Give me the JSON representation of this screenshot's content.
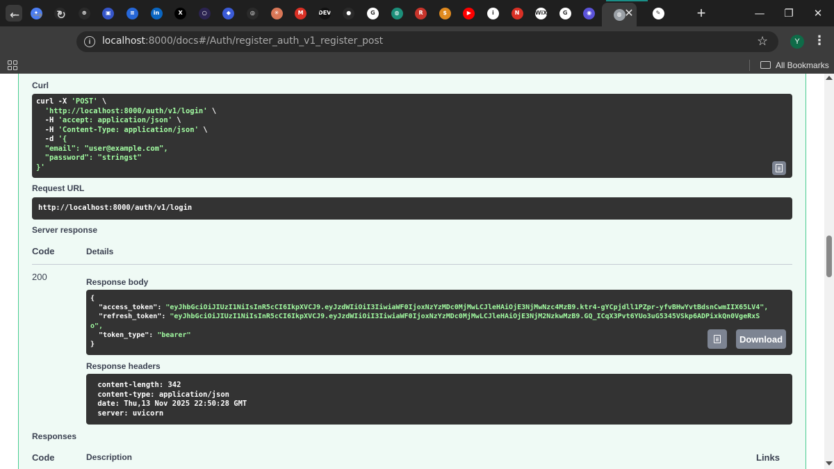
{
  "browser": {
    "tabs": [
      {
        "icon": "gemini-icon",
        "glyph": "✦",
        "color": "#4b7df2"
      },
      {
        "icon": "chatgpt-icon",
        "glyph": "⊛",
        "color": "#2a2a2a"
      },
      {
        "icon": "openai-icon",
        "glyph": "⊛",
        "color": "#2a2a2a"
      },
      {
        "icon": "save-icon",
        "glyph": "▣",
        "color": "#3656c9"
      },
      {
        "icon": "menu-app-icon",
        "glyph": "≡",
        "color": "#2667d8"
      },
      {
        "icon": "linkedin-icon",
        "glyph": "in",
        "color": "#0a66c2"
      },
      {
        "icon": "x-twitter-icon",
        "glyph": "X",
        "color": "#000000"
      },
      {
        "icon": "circle-app-icon",
        "glyph": "○",
        "color": "#2b2350"
      },
      {
        "icon": "vscode-icon",
        "glyph": "◆",
        "color": "#3b5bd6"
      },
      {
        "icon": "ring-app-icon",
        "glyph": "◎",
        "color": "#2a2a2a"
      },
      {
        "icon": "claude-icon",
        "glyph": "✳",
        "color": "#d97757"
      },
      {
        "icon": "gmail-icon",
        "glyph": "M",
        "color": "#d93025"
      },
      {
        "icon": "dev-icon",
        "glyph": "DEV",
        "color": "#111111"
      },
      {
        "icon": "github-icon",
        "glyph": "●",
        "color": "#2a2a2a"
      },
      {
        "icon": "google-icon",
        "glyph": "G",
        "color": "#ffffff"
      },
      {
        "icon": "globe-app-icon",
        "glyph": "◍",
        "color": "#1c8f7a"
      },
      {
        "icon": "redux-icon",
        "glyph": "R",
        "color": "#c7342b"
      },
      {
        "icon": "dollar-app-icon",
        "glyph": "$",
        "color": "#e08a1f"
      },
      {
        "icon": "youtube-icon",
        "glyph": "▶",
        "color": "#ff0000"
      },
      {
        "icon": "info-app-icon",
        "glyph": "i",
        "color": "#ffffff"
      },
      {
        "icon": "notion-like-icon",
        "glyph": "N",
        "color": "#d93025"
      },
      {
        "icon": "wix-icon",
        "glyph": "WiX",
        "color": "#ffffff"
      },
      {
        "icon": "google-icon",
        "glyph": "G",
        "color": "#ffffff"
      },
      {
        "icon": "chat-app-icon",
        "glyph": "◉",
        "color": "#5b53d9"
      },
      {
        "icon": "globe-icon",
        "glyph": "◍",
        "color": "#9aa0a6"
      },
      {
        "icon": "pencil-app-icon",
        "glyph": "✎",
        "color": "#ffffff"
      }
    ],
    "url_host": "localhost",
    "url_path": ":8000/docs#/Auth/register_auth_v1_register_post",
    "profile_initial": "Y",
    "all_bookmarks": "All Bookmarks"
  },
  "curl": {
    "heading": "Curl",
    "lines": [
      {
        "plain": "curl -X ",
        "str": "'POST'",
        "tail": " \\"
      },
      {
        "plain": "  ",
        "str": "'http://localhost:8000/auth/v1/login'",
        "tail": " \\"
      },
      {
        "plain": "  -H ",
        "str": "'accept: application/json'",
        "tail": " \\"
      },
      {
        "plain": "  -H ",
        "str": "'Content-Type: application/json'",
        "tail": " \\"
      },
      {
        "plain": "  -d ",
        "str": "'{",
        "tail": ""
      },
      {
        "plain": "",
        "str": "  \"email\": \"user@example.com\",",
        "tail": ""
      },
      {
        "plain": "",
        "str": "  \"password\": \"stringst\"",
        "tail": ""
      },
      {
        "plain": "",
        "str": "}'",
        "tail": ""
      }
    ]
  },
  "request_url": {
    "heading": "Request URL",
    "value": "http://localhost:8000/auth/v1/login"
  },
  "server_response": {
    "heading": "Server response",
    "code_header": "Code",
    "details_header": "Details",
    "status_code": "200",
    "body_heading": "Response body",
    "body_lines": [
      {
        "plain": "{",
        "str": ""
      },
      {
        "plain": "  \"access_token\": ",
        "str": "\"eyJhbGciOiJIUzI1NiIsInR5cCI6IkpXVCJ9.eyJzdWIiOiI3IiwiaWF0IjoxNzYzMDc0MjMwLCJleHAiOjE3NjMwNzc4MzB9.ktr4-gYCpjdll1PZpr-yfvBHwYvtBdsnCwmIIX65LV4\","
      },
      {
        "plain": "  \"refresh_token\": ",
        "str": "\"eyJhbGciOiJIUzI1NiIsInR5cCI6IkpXVCJ9.eyJzdWIiOiI3IiwiaWF0IjoxNzYzMDc0MjMwLCJleHAiOjE3NjM2NzkwMzB9.GQ_ICqX3Pvt6YUo3uG5345VSkp6ADPixkQn0VgeRxS"
      },
      {
        "plain": "",
        "str": "o\","
      },
      {
        "plain": "  \"token_type\": ",
        "str": "\"bearer\""
      },
      {
        "plain": "}",
        "str": ""
      }
    ],
    "download_label": "Download",
    "headers_heading": "Response headers",
    "header_lines": [
      " content-length: 342 ",
      " content-type: application/json ",
      " date: Thu,13 Nov 2025 22:50:28 GMT ",
      " server: uvicorn "
    ]
  },
  "responses": {
    "heading": "Responses",
    "code_header": "Code",
    "description_header": "Description",
    "links_header": "Links"
  }
}
